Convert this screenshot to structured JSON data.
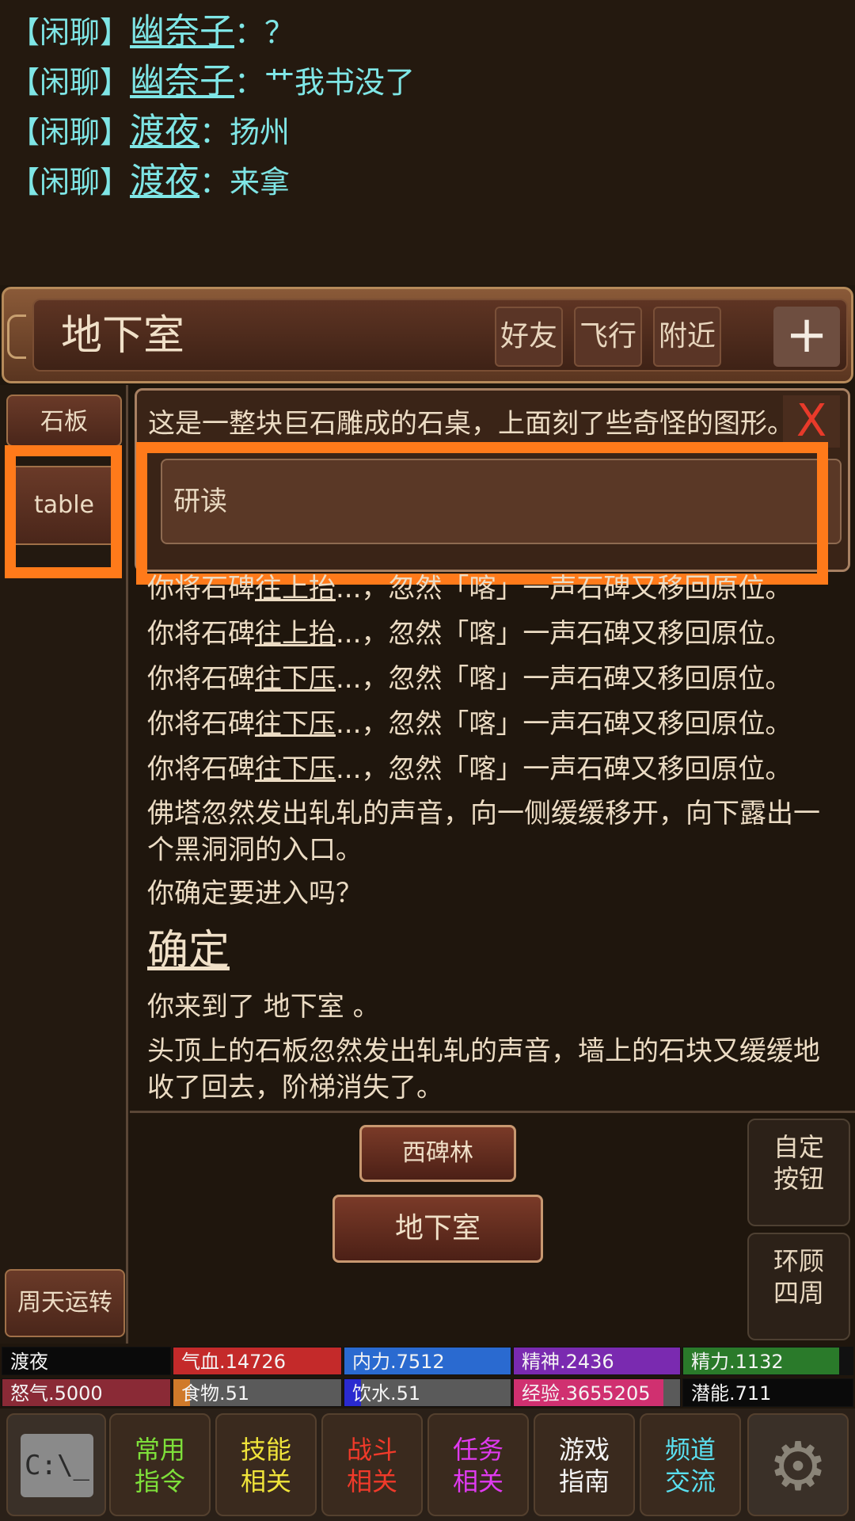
{
  "chat": [
    {
      "channel": "【闲聊】",
      "name": "幽奈子",
      "sep": "：",
      "text": "？"
    },
    {
      "channel": "【闲聊】",
      "name": "幽奈子",
      "sep": "：",
      "text": "艹我书没了"
    },
    {
      "channel": "【闲聊】",
      "name": "渡夜",
      "sep": "：",
      "text": "扬州"
    },
    {
      "channel": "【闲聊】",
      "name": "渡夜",
      "sep": "：",
      "text": "来拿"
    }
  ],
  "location": {
    "title": "地下室",
    "buttons": [
      "好友",
      "飞行",
      "附近"
    ],
    "plus": "+"
  },
  "left_items": {
    "item1": "石板",
    "item2": "table",
    "bottom": "周天运转"
  },
  "popup": {
    "description": "这是一整块巨石雕成的石桌，上面刻了些奇怪的图形。",
    "close": "X",
    "action": "研读"
  },
  "messages": {
    "line0": {
      "a": "你将石碑",
      "u": "往上抬",
      "b": "...，忽然「喀」一声石碑又移回原位。"
    },
    "line1": {
      "a": "你将石碑",
      "u": "往上抬",
      "b": "...，忽然「喀」一声石碑又移回原位。"
    },
    "line2": {
      "a": "你将石碑",
      "u": "往下压",
      "b": "...，忽然「喀」一声石碑又移回原位。"
    },
    "line3": {
      "a": "你将石碑",
      "u": "往下压",
      "b": "...，忽然「喀」一声石碑又移回原位。"
    },
    "line4": {
      "a": "你将石碑",
      "u": "往下压",
      "b": "...，忽然「喀」一声石碑又移回原位。"
    },
    "pagoda": "佛塔忽然发出轧轧的声音，向一侧缓缓移开，向下露出一个黑洞洞的入口。",
    "ask": "你确定要进入吗？",
    "confirm": "确定",
    "arrive": "你来到了 地下室 。",
    "stone": "头顶上的石板忽然发出轧轧的声音，墙上的石块又缓缓地收了回去，阶梯消失了。"
  },
  "map": {
    "north": "西碑林",
    "current": "地下室"
  },
  "side_buttons": {
    "custom1": "自定",
    "custom2": "按钮",
    "look1": "环顾",
    "look2": "四周"
  },
  "stats": {
    "name": "渡夜",
    "qixue": "气血.14726",
    "neili": "内力.7512",
    "jingshen": "精神.2436",
    "jingli": "精力.1132",
    "nuqi": "怒气.5000",
    "shiwu": "食物.51",
    "yinshui": "饮水.51",
    "jingyan": "经验.3655205",
    "qianneng": "潜能.711",
    "colors": {
      "qixue": "#c42a2a",
      "neili": "#2a6ad0",
      "jingshen": "#7a2ab0",
      "jingli": "#2a7a2a",
      "nuqi": "#8a2a36",
      "shiwu": "#d07a2a",
      "yinshui": "#2a2ad0",
      "jingyan": "#d03070"
    }
  },
  "levels": {
    "jingli": 0.92,
    "shiwu": 0.1,
    "yinshui": 0.1,
    "jingyan": 0.9
  },
  "nav": [
    {
      "l1": "常用",
      "l2": "指令",
      "color": "#7ee03a"
    },
    {
      "l1": "技能",
      "l2": "相关",
      "color": "#f0e43a"
    },
    {
      "l1": "战斗",
      "l2": "相关",
      "color": "#f03a2a"
    },
    {
      "l1": "任务",
      "l2": "相关",
      "color": "#e03af0"
    },
    {
      "l1": "游戏",
      "l2": "指南",
      "color": "#f4f4f4"
    },
    {
      "l1": "频道",
      "l2": "交流",
      "color": "#5ae0f0"
    }
  ],
  "icons": {
    "cmd": "C:\\_",
    "settings": "gear-icon"
  }
}
